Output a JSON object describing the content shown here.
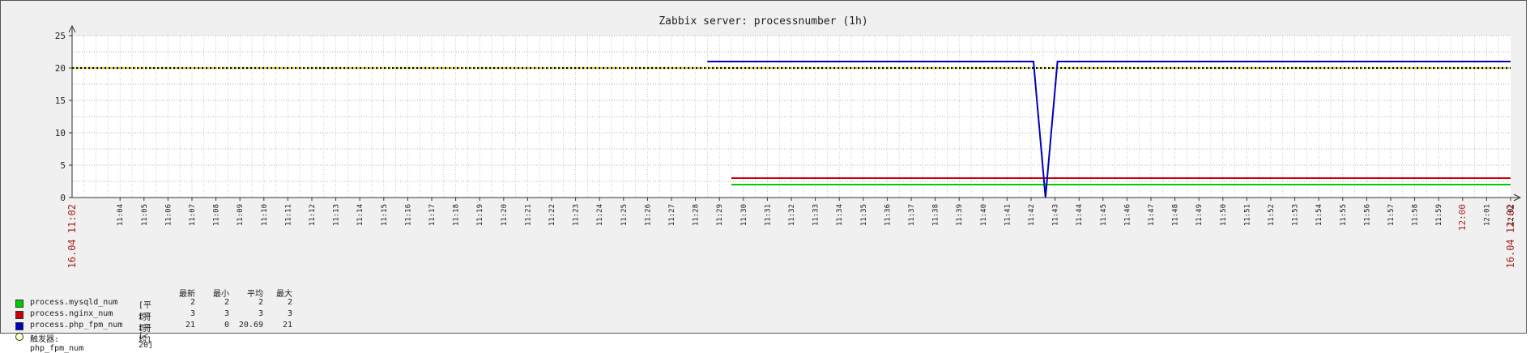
{
  "chart_data": {
    "type": "line",
    "title": "Zabbix server: processnumber (1h)",
    "ylim": [
      0,
      25
    ],
    "yticks": [
      0,
      5,
      10,
      15,
      20,
      25
    ],
    "grid": true,
    "x_start_label": "16.04 11:02",
    "x_end_label": "16.04 12:02",
    "x_ticks": [
      "11:04",
      "11:05",
      "11:06",
      "11:07",
      "11:08",
      "11:09",
      "11:10",
      "11:11",
      "11:12",
      "11:13",
      "11:14",
      "11:15",
      "11:16",
      "11:17",
      "11:18",
      "11:19",
      "11:20",
      "11:21",
      "11:22",
      "11:23",
      "11:24",
      "11:25",
      "11:26",
      "11:27",
      "11:28",
      "11:29",
      "11:30",
      "11:31",
      "11:32",
      "11:33",
      "11:34",
      "11:35",
      "11:36",
      "11:37",
      "11:38",
      "11:39",
      "11:40",
      "11:41",
      "11:42",
      "11:43",
      "11:44",
      "11:45",
      "11:46",
      "11:47",
      "11:48",
      "11:49",
      "11:50",
      "11:51",
      "11:52",
      "11:53",
      "11:54",
      "11:55",
      "11:56",
      "11:57",
      "11:58",
      "11:59",
      "12:00",
      "12:01",
      "12:02"
    ],
    "x_ticks_highlight": [
      "12:00"
    ],
    "series": [
      {
        "name": "process.mysqld_num",
        "color": "#00cc00",
        "points": [
          [
            "11:29.5",
            2
          ],
          [
            "12:02",
            2
          ]
        ]
      },
      {
        "name": "process.nginx_num",
        "color": "#cc0000",
        "points": [
          [
            "11:29.5",
            3
          ],
          [
            "12:02",
            3
          ]
        ]
      },
      {
        "name": "process.php_fpm_num",
        "color": "#0000bb",
        "points": [
          [
            "11:28.5",
            21
          ],
          [
            "11:42.1",
            21
          ],
          [
            "11:42.6",
            0
          ],
          [
            "11:43.1",
            21
          ],
          [
            "12:02",
            21
          ]
        ]
      }
    ],
    "trigger": {
      "name": "php_fpm_num",
      "value": 20,
      "color": "#cccc00"
    }
  },
  "legend": {
    "headers": [
      "最新",
      "最小",
      "平均",
      "最大"
    ],
    "rows": [
      {
        "color": "#00cc00",
        "name": "process.mysqld_num",
        "func": "[平均]",
        "last": "2",
        "min": "2",
        "avg": "2",
        "max": "2"
      },
      {
        "color": "#cc0000",
        "name": "process.nginx_num",
        "func": "[平均]",
        "last": "3",
        "min": "3",
        "avg": "3",
        "max": "3"
      },
      {
        "color": "#0000bb",
        "name": "process.php_fpm_num",
        "func": "[平均]",
        "last": "21",
        "min": "0",
        "avg": "20.69",
        "max": "21"
      }
    ],
    "trigger": {
      "label": "触发器: php_fpm_num",
      "condition": "[< 20]"
    }
  }
}
